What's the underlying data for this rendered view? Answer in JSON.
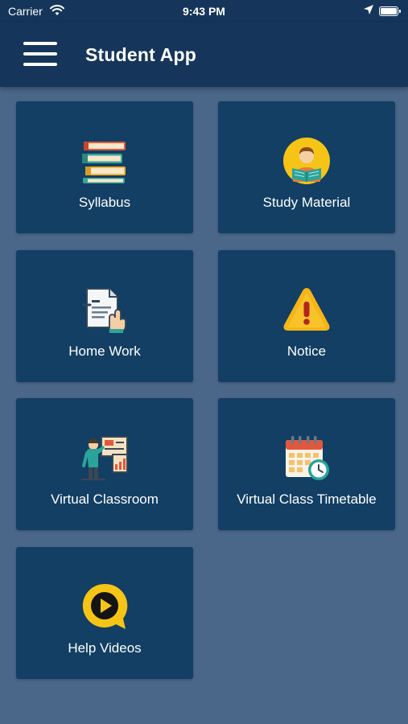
{
  "status_bar": {
    "carrier": "Carrier",
    "time": "9:43 PM"
  },
  "navbar": {
    "title": "Student App",
    "menu_icon": "hamburger-menu-icon"
  },
  "tiles": [
    {
      "label": "Syllabus",
      "icon": "books-icon"
    },
    {
      "label": "Study Material",
      "icon": "student-reading-icon"
    },
    {
      "label": "Home Work",
      "icon": "document-hand-icon"
    },
    {
      "label": "Notice",
      "icon": "warning-icon"
    },
    {
      "label": "Virtual Classroom",
      "icon": "teacher-board-icon"
    },
    {
      "label": "Virtual Class Timetable",
      "icon": "calendar-clock-icon"
    },
    {
      "label": "Help Videos",
      "icon": "play-bubble-icon"
    }
  ],
  "colors": {
    "background": "#4a6789",
    "header": "#15365a",
    "tile": "#123f63",
    "text": "#ffffff",
    "accent_yellow": "#f6c416",
    "accent_red": "#e24b3c"
  }
}
